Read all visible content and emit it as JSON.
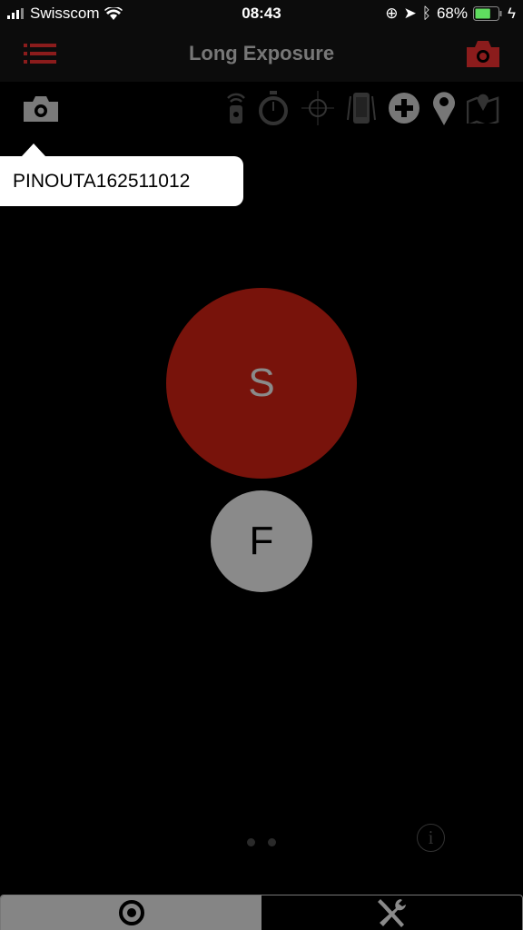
{
  "status_bar": {
    "carrier": "Swisscom",
    "time": "08:43",
    "battery_percent": "68%",
    "battery_level": 0.68
  },
  "nav": {
    "title": "Long Exposure",
    "menu_icon": "list-icon",
    "camera_icon": "camera-icon"
  },
  "toolbar": {
    "icons": [
      "camera-icon",
      "remote-icon",
      "stopwatch-icon",
      "crosshair-icon",
      "phone-shake-icon",
      "plus-circle-icon",
      "location-pin-icon",
      "map-icon"
    ]
  },
  "tooltip": {
    "text": "PINOUTA162511012"
  },
  "main": {
    "s_button": "S",
    "f_button": "F",
    "pages": 2
  },
  "tabs": [
    {
      "icon": "target-icon",
      "active": true
    },
    {
      "icon": "tools-icon",
      "active": false
    }
  ],
  "colors": {
    "accent": "#8b1c1c",
    "s_button": "#78130b",
    "f_button": "#8a8a8a",
    "battery": "#5fdc5f"
  }
}
